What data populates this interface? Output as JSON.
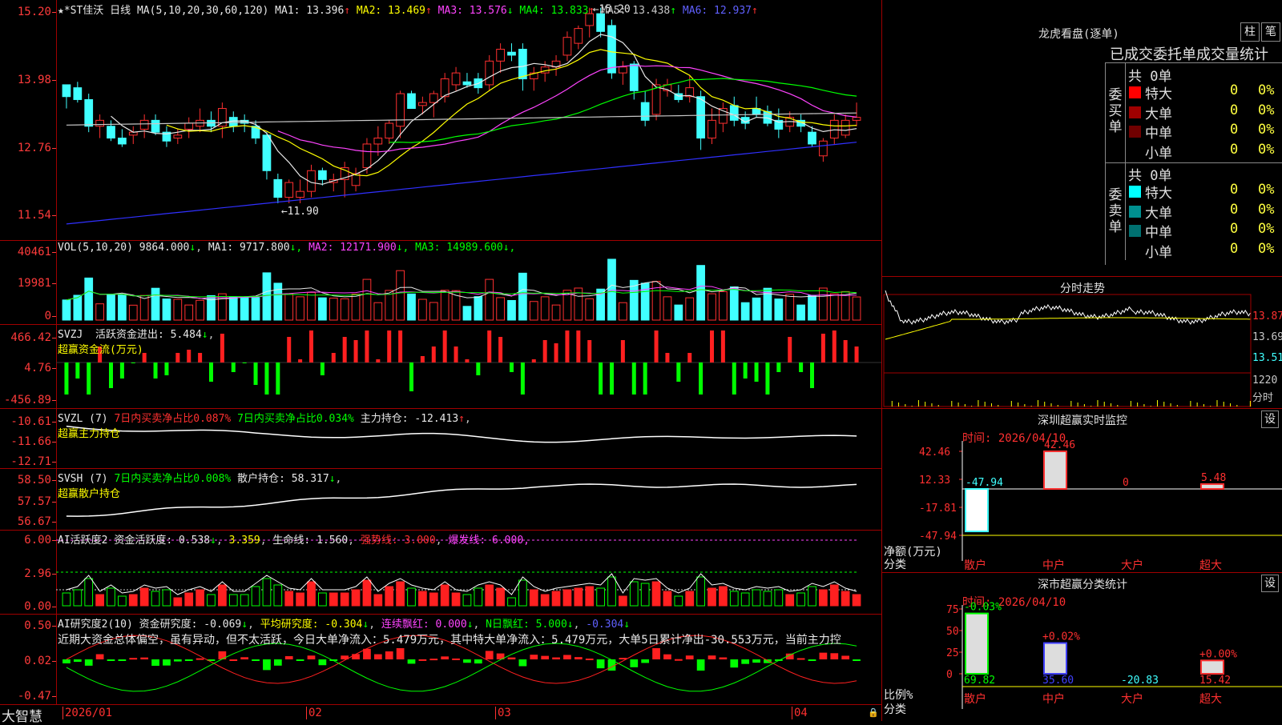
{
  "chart_data": [
    {
      "type": "candlestick",
      "title": "★*ST佳沃 日线",
      "ma_label": "MA(5,10,20,30,60,120)",
      "ma": [
        {
          "name": "MA1",
          "value": "13.396",
          "color": "#e8e8e8"
        },
        {
          "name": "MA2",
          "value": "13.469",
          "color": "#ffff00"
        },
        {
          "name": "MA3",
          "value": "13.576",
          "color": "#ff44ff"
        },
        {
          "name": "MA4",
          "value": "13.833",
          "color": "#00ff00"
        },
        {
          "name": "MA5",
          "value": "13.438",
          "color": "#c8c8c8"
        },
        {
          "name": "MA6",
          "value": "12.937",
          "color": "#6060ff"
        }
      ],
      "y_ticks": [
        "15.20",
        "13.98",
        "12.76",
        "11.54"
      ],
      "ylim": [
        11.4,
        15.25
      ],
      "annotations": [
        "15.20",
        "11.90"
      ],
      "x_ticks": [
        "2026/01",
        "02",
        "03",
        "04"
      ],
      "candles": [
        [
          13.9,
          13.9,
          13.5,
          13.7
        ],
        [
          13.85,
          13.95,
          13.6,
          13.65
        ],
        [
          13.65,
          13.75,
          13.1,
          13.2
        ],
        [
          13.2,
          13.4,
          13.0,
          13.3
        ],
        [
          13.2,
          13.3,
          12.95,
          13.0
        ],
        [
          13.0,
          13.15,
          12.85,
          12.9
        ],
        [
          13.05,
          13.2,
          12.9,
          13.1
        ],
        [
          13.15,
          13.4,
          13.0,
          13.3
        ],
        [
          13.3,
          13.4,
          13.05,
          13.1
        ],
        [
          13.1,
          13.2,
          12.85,
          12.95
        ],
        [
          13.0,
          13.15,
          12.9,
          13.05
        ],
        [
          13.15,
          13.35,
          13.0,
          13.25
        ],
        [
          13.2,
          13.5,
          13.1,
          13.3
        ],
        [
          13.3,
          13.45,
          13.1,
          13.2
        ],
        [
          13.2,
          13.6,
          13.0,
          13.5
        ],
        [
          13.35,
          13.45,
          13.1,
          13.2
        ],
        [
          13.3,
          13.4,
          13.1,
          13.25
        ],
        [
          13.2,
          13.3,
          12.9,
          13.0
        ],
        [
          13.05,
          13.1,
          12.3,
          12.45
        ],
        [
          12.3,
          12.4,
          11.9,
          12.0
        ],
        [
          12.0,
          12.3,
          11.9,
          12.25
        ],
        [
          12.0,
          12.3,
          11.9,
          12.1
        ],
        [
          12.1,
          12.55,
          12.0,
          12.45
        ],
        [
          12.45,
          12.5,
          12.2,
          12.3
        ],
        [
          12.25,
          12.4,
          12.1,
          12.3
        ],
        [
          12.3,
          12.6,
          12.0,
          12.5
        ],
        [
          12.2,
          12.5,
          12.1,
          12.4
        ],
        [
          12.5,
          13.0,
          12.4,
          12.9
        ],
        [
          12.9,
          13.2,
          12.7,
          13.0
        ],
        [
          13.0,
          13.3,
          12.9,
          13.25
        ],
        [
          13.2,
          13.8,
          13.0,
          13.75
        ],
        [
          13.75,
          13.8,
          13.5,
          13.5
        ],
        [
          13.55,
          13.7,
          13.4,
          13.6
        ],
        [
          13.6,
          13.8,
          13.35,
          13.75
        ],
        [
          13.7,
          14.1,
          13.6,
          14.0
        ],
        [
          13.9,
          14.2,
          13.8,
          14.1
        ],
        [
          13.95,
          14.1,
          13.85,
          13.9
        ],
        [
          14.0,
          14.1,
          13.75,
          13.85
        ],
        [
          13.9,
          14.4,
          13.8,
          14.3
        ],
        [
          14.3,
          14.6,
          14.1,
          14.5
        ],
        [
          14.45,
          14.6,
          14.3,
          14.4
        ],
        [
          14.5,
          14.6,
          13.8,
          14.0
        ],
        [
          14.0,
          14.2,
          13.8,
          14.1
        ],
        [
          14.1,
          14.3,
          13.95,
          14.2
        ],
        [
          14.2,
          14.4,
          14.05,
          14.3
        ],
        [
          14.4,
          14.8,
          14.3,
          14.7
        ],
        [
          14.6,
          14.9,
          14.5,
          14.85
        ],
        [
          14.9,
          15.2,
          14.7,
          15.1
        ],
        [
          15.1,
          15.2,
          14.7,
          14.8
        ],
        [
          14.9,
          15.0,
          14.0,
          14.1
        ],
        [
          14.1,
          14.3,
          13.9,
          14.2
        ],
        [
          14.25,
          14.3,
          13.65,
          13.8
        ],
        [
          13.6,
          13.8,
          13.2,
          13.3
        ],
        [
          13.4,
          14.0,
          13.3,
          13.9
        ],
        [
          13.8,
          14.0,
          13.7,
          13.9
        ],
        [
          13.75,
          13.9,
          13.6,
          13.65
        ],
        [
          13.7,
          14.05,
          13.6,
          13.85
        ],
        [
          13.7,
          13.8,
          12.8,
          13.0
        ],
        [
          13.0,
          13.5,
          12.9,
          13.3
        ],
        [
          13.25,
          13.6,
          13.1,
          13.5
        ],
        [
          13.55,
          13.7,
          13.2,
          13.3
        ],
        [
          13.35,
          13.45,
          13.15,
          13.25
        ],
        [
          13.5,
          13.7,
          13.35,
          13.4
        ],
        [
          13.45,
          13.55,
          13.2,
          13.25
        ],
        [
          13.3,
          13.5,
          13.0,
          13.15
        ],
        [
          13.2,
          13.45,
          13.1,
          13.35
        ],
        [
          13.3,
          13.4,
          13.1,
          13.2
        ],
        [
          13.1,
          13.2,
          12.85,
          12.9
        ],
        [
          12.7,
          13.0,
          12.6,
          12.95
        ],
        [
          13.0,
          13.4,
          12.9,
          13.3
        ],
        [
          13.05,
          13.4,
          13.0,
          13.3
        ],
        [
          13.3,
          13.6,
          13.2,
          13.35
        ]
      ]
    },
    {
      "type": "bar",
      "title": "VOL(5,10,20)",
      "value": "9864.000",
      "ma": [
        {
          "name": "MA1",
          "value": "9717.800",
          "color": "#e8e8e8"
        },
        {
          "name": "MA2",
          "value": "12171.900",
          "color": "#ff44ff"
        },
        {
          "name": "MA3",
          "value": "14989.600",
          "color": "#00ff00"
        }
      ],
      "y_ticks": [
        "40461",
        "19981",
        "0"
      ],
      "ylim": [
        0,
        42000
      ]
    },
    {
      "type": "bar",
      "title": "SVZJ",
      "label": "活跃资金进出",
      "value": "5.484",
      "sub_label": "超赢资金流(万元)",
      "y_ticks": [
        "466.42",
        "4.76",
        "-456.89"
      ],
      "ylim": [
        -470,
        470
      ]
    },
    {
      "type": "line",
      "title": "SVZL (7)",
      "label1": "7日内买卖净占比0.087%",
      "label2": "7日内买卖净占比0.034%",
      "label3": "主力持仓",
      "value": "-12.413",
      "sub_label": "超赢主力持仓",
      "y_ticks": [
        "-10.61",
        "-11.66",
        "-12.71"
      ]
    },
    {
      "type": "line",
      "title": "SVSH (7)",
      "label1": "7日内买卖净占比0.008%",
      "label2": "散户持仓",
      "value": "58.317",
      "sub_label": "超赢散户持仓",
      "y_ticks": [
        "58.50",
        "57.57",
        "56.67"
      ]
    },
    {
      "type": "bar",
      "title": "AI活跃度2",
      "label1": "资金活跃度",
      "v1": "0.538",
      "v2": "3.359",
      "label2": "生命线",
      "v3": "1.560",
      "label3": "强势线",
      "v4": "3.000",
      "label4": "爆发线",
      "v5": "6.000",
      "y_ticks": [
        "6.00",
        "2.96",
        "0.00"
      ]
    },
    {
      "type": "bar",
      "title": "AI研究度2(10)",
      "label1": "资金研究度",
      "v1": "-0.069",
      "label2": "平均研究度",
      "v2": "-0.304",
      "label3": "连续飘红",
      "v3": "0.000",
      "label4": "N日飘红",
      "v4": "5.000",
      "v5": "-0.304",
      "comment": "近期大资金总体偏空，虽有异动，但不太活跃，今日大单净流入：5.479万元，其中特大单净流入：5.479万元，大单5日累计净出-30.553万元，当前主力控",
      "y_ticks": [
        "0.50",
        "0.02",
        "-0.47"
      ]
    }
  ],
  "brand": "大智慧",
  "right": {
    "lhb_title": "龙虎看盘(逐单)",
    "btn1": "柱",
    "btn2": "笔",
    "stat_title": "已成交委托单成交量统计",
    "buy_side": "委买单",
    "sell_side": "委卖单",
    "buy_total": "共 0单",
    "sell_total": "共 0单",
    "buy_rows": [
      {
        "label": "特大",
        "n": "0",
        "p": "0%",
        "color": "#ff0000"
      },
      {
        "label": "大单",
        "n": "0",
        "p": "0%",
        "color": "#a00000"
      },
      {
        "label": "中单",
        "n": "0",
        "p": "0%",
        "color": "#700000"
      },
      {
        "label": "小单",
        "n": "0",
        "p": "0%",
        "color": "#000000"
      }
    ],
    "sell_rows": [
      {
        "label": "特大",
        "n": "0",
        "p": "0%",
        "color": "#00ffff"
      },
      {
        "label": "大单",
        "n": "0",
        "p": "0%",
        "color": "#009090"
      },
      {
        "label": "中单",
        "n": "0",
        "p": "0%",
        "color": "#007070"
      },
      {
        "label": "小单",
        "n": "0",
        "p": "0%",
        "color": "#000000"
      }
    ],
    "intraday_title": "分时走势",
    "intraday_ticks": [
      "13.87",
      "13.69",
      "13.51",
      "1220",
      "分时"
    ],
    "monitor_title": "深圳超赢实时监控",
    "monitor_btn": "设",
    "monitor_time": "时间: 2026/04/10",
    "monitor_ticks": [
      "42.46",
      "12.33",
      "-17.81",
      "-47.94"
    ],
    "monitor_ylabel": "净额(万元)",
    "monitor_xlabel": "分类",
    "monitor_bars": [
      {
        "cat": "散户",
        "value": -47.94,
        "label": "-47.94"
      },
      {
        "cat": "中户",
        "value": 42.46,
        "label": "42.46"
      },
      {
        "cat": "大户",
        "value": 0,
        "label": "0"
      },
      {
        "cat": "超大",
        "value": 5.48,
        "label": "5.48"
      }
    ],
    "class_title": "深市超赢分类统计",
    "class_btn": "设",
    "class_time": "时间: 2026/04/10",
    "class_ticks": [
      "75",
      "50",
      "25",
      "0"
    ],
    "class_ylabel": "比例%",
    "class_xlabel": "分类",
    "class_bars": [
      {
        "cat": "散户",
        "value": 69.82,
        "label": "69.82",
        "chg": "-0.03%"
      },
      {
        "cat": "中户",
        "value": 35.6,
        "label": "35.60",
        "chg": "+0.02%"
      },
      {
        "cat": "大户",
        "value": -20.83,
        "label": "-20.83",
        "chg": ""
      },
      {
        "cat": "超大",
        "value": 15.42,
        "label": "15.42",
        "chg": "+0.00%"
      }
    ]
  }
}
